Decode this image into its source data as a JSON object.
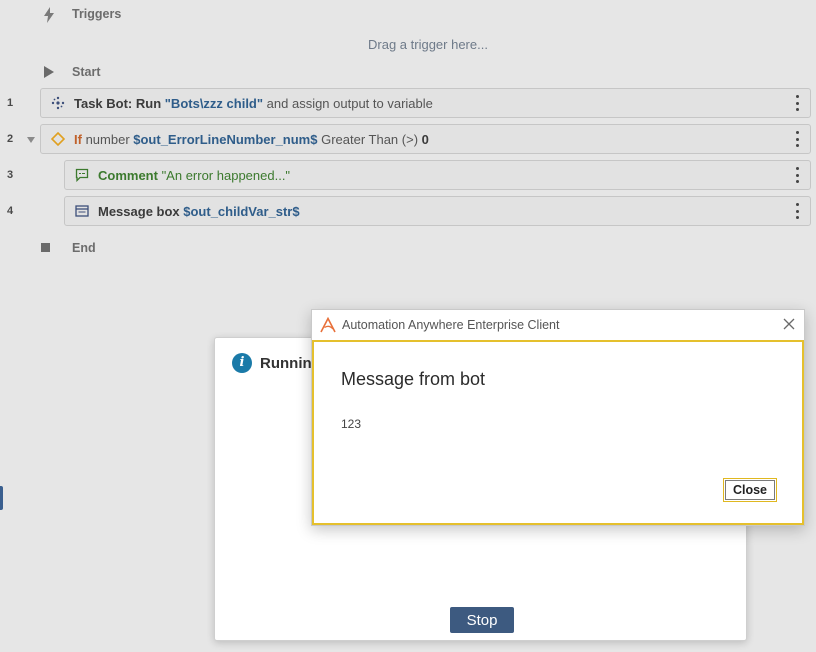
{
  "editor": {
    "triggers_label": "Triggers",
    "drop_hint": "Drag a trigger here...",
    "start_label": "Start",
    "end_label": "End",
    "rows": [
      {
        "line": "1",
        "icon": "task-bot-icon",
        "parts": [
          {
            "t": "Task Bot: Run ",
            "c": "b"
          },
          {
            "t": "\"Bots\\zzz child\"",
            "c": "v"
          },
          {
            "t": " and assign output to variable",
            "c": ""
          }
        ]
      },
      {
        "line": "2",
        "icon": "if-diamond-icon",
        "parts": [
          {
            "t": "If",
            "c": "o"
          },
          {
            "t": " number ",
            "c": ""
          },
          {
            "t": "$out_ErrorLineNumber_num$",
            "c": "v"
          },
          {
            "t": " Greater Than (>) ",
            "c": ""
          },
          {
            "t": "0",
            "c": "b"
          }
        ]
      },
      {
        "line": "3",
        "icon": "comment-icon",
        "parts": [
          {
            "t": "Comment ",
            "c": "g"
          },
          {
            "t": "\"An error happened...\"",
            "c": "g"
          }
        ]
      },
      {
        "line": "4",
        "icon": "message-box-icon",
        "parts": [
          {
            "t": "Message box ",
            "c": "b"
          },
          {
            "t": "$out_childVar_str$",
            "c": "v"
          }
        ]
      }
    ]
  },
  "running_dialog": {
    "title": "Running",
    "stop_label": "Stop"
  },
  "message_dialog": {
    "window_title": "Automation Anywhere Enterprise Client",
    "heading": "Message from bot",
    "message": "123",
    "close_label": "Close"
  },
  "colors": {
    "accent_yellow": "#e5c02d",
    "stop_button": "#3d5a80",
    "info_blue": "#1a7aa8",
    "logo_orange": "#e8703a"
  }
}
